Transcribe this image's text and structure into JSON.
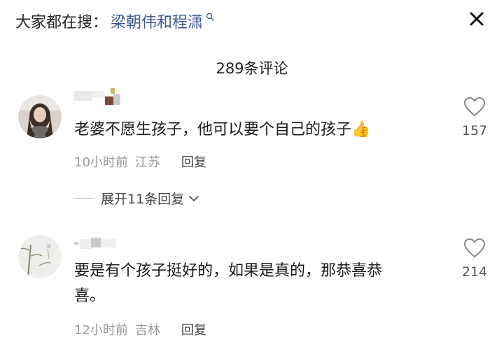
{
  "search": {
    "prefix": "大家都在搜：",
    "query": "梁朝伟和程潇"
  },
  "comments_header": {
    "count_label": "289条评论"
  },
  "comments": [
    {
      "text": "老婆不愿生孩子，他可以要个自己的孩子👍",
      "time": "10小时前",
      "location": "江苏",
      "reply_label": "回复",
      "likes": "157",
      "replies_expand": "展开11条回复"
    },
    {
      "text_line1": "要是有个孩子挺好的，如果是真的，那恭喜恭",
      "text_line2": "喜。",
      "time": "12小时前",
      "location": "吉林",
      "reply_label": "回复",
      "likes": "214"
    }
  ],
  "colors": {
    "query_blue": "#3e5a8f",
    "meta_gray": "#999999"
  }
}
